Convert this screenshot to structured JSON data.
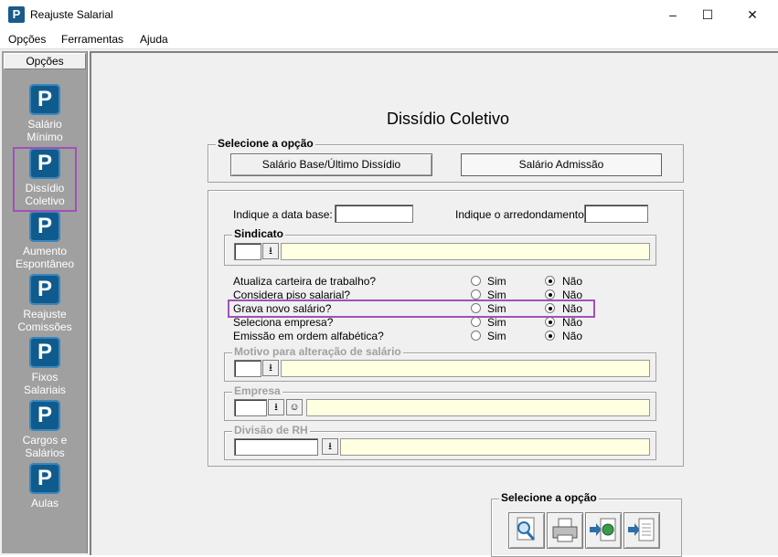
{
  "window": {
    "title": "Reajuste Salarial",
    "min": "–",
    "max": "☐",
    "close": "✕"
  },
  "menu": [
    "Opções",
    "Ferramentas",
    "Ajuda"
  ],
  "sidebar": {
    "header": "Opções",
    "items": [
      {
        "label": "Salário\nMínimo"
      },
      {
        "label": "Dissídio\nColetivo"
      },
      {
        "label": "Aumento\nEspontâneo"
      },
      {
        "label": "Reajuste\nComissões"
      },
      {
        "label": "Fixos\nSalariais"
      },
      {
        "label": "Cargos e\nSalários"
      },
      {
        "label": "Aulas"
      }
    ]
  },
  "main": {
    "title": "Dissídio Coletivo",
    "option_group": {
      "title": "Selecione a opção",
      "btn_base": "Salário Base/Último Dissídio",
      "btn_admissao": "Salário Admissão"
    },
    "data_base_label": "Indique a data base:",
    "arred_label": "Indique o arredondamento:",
    "sindicato_title": "Sindicato",
    "questions": [
      {
        "label": "Atualiza carteira de trabalho?",
        "sim": "Sim",
        "nao": "Não",
        "value": "nao"
      },
      {
        "label": "Considera piso salarial?",
        "sim": "Sim",
        "nao": "Não",
        "value": "nao"
      },
      {
        "label": "Grava novo salário?",
        "sim": "Sim",
        "nao": "Não",
        "value": "nao"
      },
      {
        "label": "Seleciona empresa?",
        "sim": "Sim",
        "nao": "Não",
        "value": "nao"
      },
      {
        "label": "Emissão em ordem alfabética?",
        "sim": "Sim",
        "nao": "Não",
        "value": "nao"
      }
    ],
    "motivo_title": "Motivo para alteração de salário",
    "empresa_title": "Empresa",
    "divisao_title": "Divisão de RH",
    "bottom_group_title": "Selecione a opção"
  },
  "colors": {
    "highlight": "#a051b7",
    "field_yellow": "#ffffe1",
    "icon_blue": "#0f5b8e"
  }
}
